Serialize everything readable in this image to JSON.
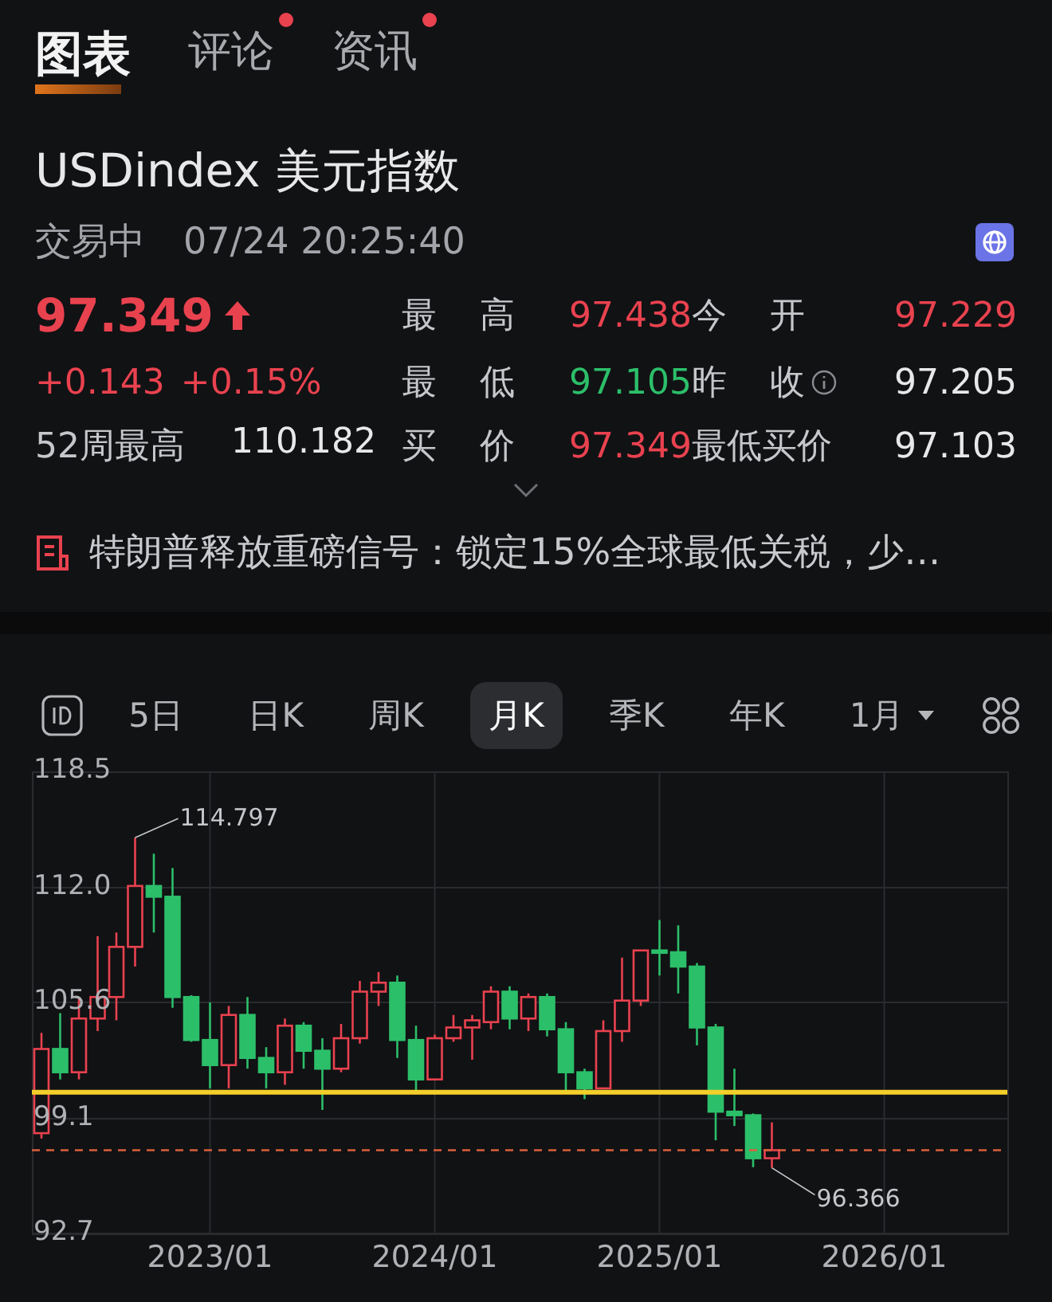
{
  "tabs": [
    {
      "label": "图表",
      "selected": true,
      "badge": false
    },
    {
      "label": "评论",
      "selected": false,
      "badge": true
    },
    {
      "label": "资讯",
      "selected": false,
      "badge": true
    }
  ],
  "quote": {
    "symbol": "USDindex",
    "name": "美元指数",
    "status": "交易中",
    "time": "07/24 20:25:40",
    "price": "97.349",
    "rising": true,
    "change": "+0.143",
    "change_pct": "+0.15%",
    "week52_label": "52周最高",
    "week52_value": "110.182",
    "stats": [
      {
        "label": "最 高",
        "value": "97.438",
        "color": "#e9424f",
        "info": false
      },
      {
        "label": "今 开",
        "value": "97.229",
        "color": "#e9424f",
        "info": false
      },
      {
        "label": "最 低",
        "value": "97.105",
        "color": "#2cbf6a",
        "info": false
      },
      {
        "label": "昨 收",
        "value": "97.205",
        "color": "#e8e8ea",
        "info": true
      },
      {
        "label": "买 价",
        "value": "97.349",
        "color": "#e9424f",
        "info": false
      },
      {
        "label": "最低买价",
        "value": "97.103",
        "color": "#e8e8ea",
        "info": false
      }
    ]
  },
  "news": {
    "headline": "特朗普释放重磅信号：锁定15%全球最低关税，少…"
  },
  "periods": [
    {
      "label": "5日",
      "selected": false,
      "kind": "tab"
    },
    {
      "label": "日K",
      "selected": false,
      "kind": "tab"
    },
    {
      "label": "周K",
      "selected": false,
      "kind": "tab"
    },
    {
      "label": "月K",
      "selected": true,
      "kind": "tab"
    },
    {
      "label": "季K",
      "selected": false,
      "kind": "tab"
    },
    {
      "label": "年K",
      "selected": false,
      "kind": "tab"
    },
    {
      "label": "1月",
      "selected": false,
      "kind": "dropdown"
    }
  ],
  "chart": {
    "chart_data": {
      "type": "candlestick",
      "categories": [
        null,
        null,
        null,
        null,
        null,
        null,
        null,
        null,
        null,
        "2023/01",
        null,
        null,
        null,
        null,
        null,
        null,
        null,
        null,
        null,
        null,
        null,
        "2024/01",
        null,
        null,
        null,
        null,
        null,
        null,
        null,
        null,
        null,
        null,
        null,
        "2025/01",
        null,
        null,
        null,
        null,
        null,
        null,
        null,
        null,
        null,
        null,
        null,
        "2026/01"
      ],
      "ohlc": [
        [
          98.3,
          103.9,
          98.0,
          103.0
        ],
        [
          103.0,
          105.0,
          101.3,
          101.7
        ],
        [
          101.7,
          105.8,
          101.3,
          104.7
        ],
        [
          104.7,
          109.3,
          104.0,
          105.9
        ],
        [
          105.9,
          109.5,
          104.6,
          108.7
        ],
        [
          108.7,
          114.797,
          107.6,
          112.1
        ],
        [
          112.1,
          113.9,
          109.5,
          111.5
        ],
        [
          111.5,
          113.1,
          105.3,
          105.9
        ],
        [
          105.9,
          106.0,
          103.4,
          103.5
        ],
        [
          103.5,
          105.6,
          100.8,
          102.1
        ],
        [
          102.1,
          105.4,
          100.8,
          104.9
        ],
        [
          104.9,
          105.9,
          101.9,
          102.5
        ],
        [
          102.5,
          103.1,
          100.8,
          101.7
        ],
        [
          101.7,
          104.7,
          101.0,
          104.3
        ],
        [
          104.3,
          104.5,
          101.9,
          102.9
        ],
        [
          102.9,
          103.6,
          99.6,
          101.9
        ],
        [
          101.9,
          104.4,
          101.7,
          103.6
        ],
        [
          103.6,
          106.8,
          103.3,
          106.2
        ],
        [
          106.2,
          107.3,
          105.4,
          106.7
        ],
        [
          106.7,
          107.1,
          102.5,
          103.5
        ],
        [
          103.5,
          104.3,
          100.6,
          101.3
        ],
        [
          101.3,
          103.8,
          101.3,
          103.6
        ],
        [
          103.6,
          104.9,
          103.4,
          104.2
        ],
        [
          104.2,
          104.9,
          102.4,
          104.6
        ],
        [
          104.5,
          106.5,
          104.1,
          106.2
        ],
        [
          106.2,
          106.5,
          104.1,
          104.7
        ],
        [
          104.7,
          106.1,
          104.0,
          105.9
        ],
        [
          105.9,
          106.1,
          103.7,
          104.1
        ],
        [
          104.1,
          104.5,
          100.5,
          101.7
        ],
        [
          101.7,
          101.9,
          100.2,
          100.8
        ],
        [
          100.8,
          104.6,
          100.8,
          104.0
        ],
        [
          104.0,
          108.1,
          103.4,
          105.7
        ],
        [
          105.7,
          108.5,
          105.4,
          108.5
        ],
        [
          108.5,
          110.2,
          107.1,
          108.4
        ],
        [
          108.4,
          109.9,
          106.1,
          107.6
        ],
        [
          107.6,
          107.8,
          103.2,
          104.2
        ],
        [
          104.2,
          104.4,
          97.9,
          99.5
        ],
        [
          99.5,
          101.9,
          98.7,
          99.3
        ],
        [
          99.3,
          99.4,
          96.4,
          96.9
        ],
        [
          96.9,
          98.9,
          96.366,
          97.349
        ],
        null,
        null,
        null,
        null,
        null,
        null
      ],
      "ylim": [
        92.7,
        118.5
      ],
      "yticks": [
        {
          "value": 118.5,
          "label": "118.5"
        },
        {
          "value": 112.0,
          "label": "112.0"
        },
        {
          "value": 105.6,
          "label": "105.6"
        },
        {
          "value": 99.1,
          "label": "99.1"
        },
        {
          "value": 92.7,
          "label": "92.7"
        }
      ],
      "grid": true,
      "ref_lines": [
        {
          "axis": "y",
          "value": 100.58,
          "color": "#f4cf2a"
        },
        {
          "axis": "y",
          "value": 97.349,
          "color": "#d9603c"
        }
      ],
      "annotations": [
        "114.797",
        "96.366"
      ]
    }
  }
}
